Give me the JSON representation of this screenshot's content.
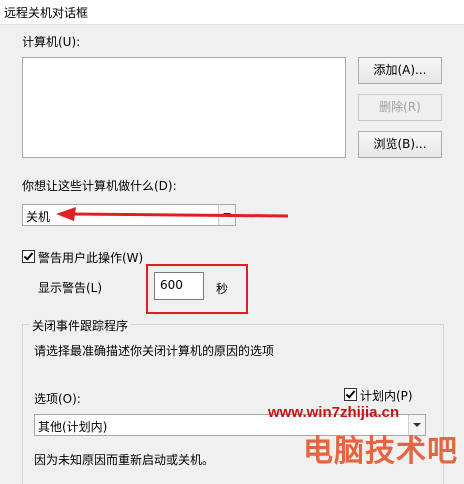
{
  "window": {
    "title": "远程关机对话框"
  },
  "computers": {
    "label": "计算机(U):"
  },
  "buttons": {
    "add": "添加(A)...",
    "remove": "删除(R)",
    "browse": "浏览(B)..."
  },
  "action": {
    "label": "你想让这些计算机做什么(D):",
    "selected": "关机"
  },
  "warn": {
    "checkbox_label": "警告用户此操作(W)",
    "checked": true,
    "display_label": "显示警告(L)",
    "seconds_value": "600",
    "seconds_unit": "秒"
  },
  "shutdown_event": {
    "legend": "关闭事件跟踪程序",
    "instruction": "请选择最准确描述你关闭计算机的原因的选项",
    "options_label": "选项(O):",
    "planned_label": "计划内(P)",
    "planned_checked": true,
    "selected_option": "其他(计划内)",
    "description": "因为未知原因而重新启动或关机。"
  },
  "watermark": {
    "url": "www.win7zhijia.cn",
    "brand": "电脑技术吧"
  },
  "colors": {
    "annotation_red": "#e02020",
    "window_bg": "#f0f0f0"
  }
}
